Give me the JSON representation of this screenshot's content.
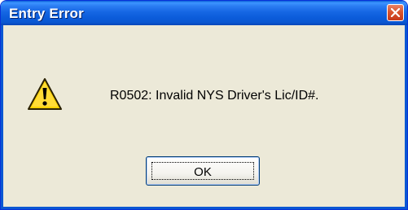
{
  "window": {
    "title": "Entry Error"
  },
  "icons": {
    "warning": "warning-triangle-icon",
    "close": "close-icon"
  },
  "message": {
    "text": "R0502: Invalid NYS Driver's Lic/ID#."
  },
  "buttons": {
    "ok_label": "OK"
  },
  "colors": {
    "titlebar": "#0a5fd8",
    "close_button": "#d9552f",
    "dialog_background": "#ece9d8",
    "warning_fill": "#ffd200"
  }
}
